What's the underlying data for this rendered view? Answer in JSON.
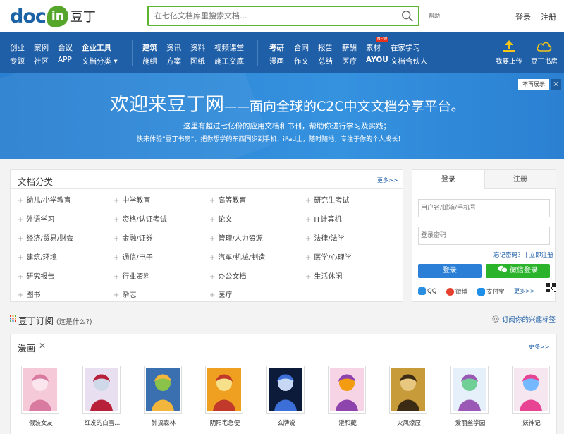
{
  "header": {
    "logo_doc": "doc",
    "logo_in": "in",
    "logo_cn": "豆丁",
    "search_placeholder": "在七亿文档库里搜索文档...",
    "help": "帮助",
    "login": "登录",
    "register": "注册"
  },
  "nav": {
    "group1_row1": [
      "创业",
      "案例",
      "会议",
      "企业工具"
    ],
    "group1_row2": [
      "专题",
      "社区",
      "APP",
      "文档分类 ▾"
    ],
    "group2_row1": [
      "建筑",
      "资讯",
      "资料",
      "视频课堂"
    ],
    "group2_row2": [
      "施组",
      "方案",
      "图纸",
      "施工交底"
    ],
    "group3_row1": [
      "考研",
      "合同",
      "报告",
      "薪酬",
      "素材",
      "在家学习"
    ],
    "group3_row2": [
      "漫画",
      "作文",
      "总结",
      "医疗",
      "AYOU",
      "文档合伙人"
    ],
    "new_badge": "NEW",
    "upload": "我要上传",
    "bookroom": "豆丁书房"
  },
  "banner": {
    "title_main": "欢迎来豆丁网",
    "title_dash": "——",
    "title_rest": "面向全球的C2C中文文档分享平台。",
    "sub1": "这里有超过七亿份的应用文档和书刊，帮助你进行学习及实践；",
    "sub2": "快来体验“豆丁书房”，把你想学的东西同步到手机、iPad上，随时随地，专注于你的个人成长！",
    "hide": "不再展示",
    "close": "×"
  },
  "categories": {
    "title": "文档分类",
    "more": "更多>>",
    "col1": [
      "幼儿/小学教育",
      "外语学习",
      "经济/贸易/财会",
      "建筑/环境",
      "研究报告",
      "图书"
    ],
    "col2": [
      "中学教育",
      "资格/认证考试",
      "金融/证券",
      "通信/电子",
      "行业资料",
      "杂志"
    ],
    "col3": [
      "高等教育",
      "论文",
      "管理/人力资源",
      "汽车/机械/制造",
      "办公文档",
      "医疗"
    ],
    "col4": [
      "研究生考试",
      "IT计算机",
      "法律/法学",
      "医学/心理学",
      "生活休闲"
    ]
  },
  "login": {
    "tab_login": "登录",
    "tab_register": "注册",
    "username_placeholder": "用户名/邮箱/手机号",
    "password_placeholder": "登录密码",
    "forgot": "忘记密码？",
    "divider": " | ",
    "register_now": "立即注册",
    "login_button": "登录",
    "wechat_button": "微信登录",
    "social": [
      "QQ",
      "微博",
      "支付宝"
    ],
    "more": "更多>>"
  },
  "subscribe": {
    "title": "豆丁订阅",
    "what": "(这是什么?)",
    "right": "订阅你的兴趣标签"
  },
  "comics": {
    "title": "漫画",
    "close": "✕",
    "more": "更多>>",
    "items": [
      "假装女友",
      "红发的白雪...",
      "钟搞森林",
      "阴阳宅急便",
      "玄牌说",
      "澄和藏",
      "火凤燎原",
      "爱丽丝学园",
      "妖神记"
    ]
  },
  "colors": {
    "brand_blue": "#1f5fa8",
    "accent_green": "#5cb532",
    "banner_blue": "#3592df",
    "wechat_green": "#2ab32b"
  }
}
